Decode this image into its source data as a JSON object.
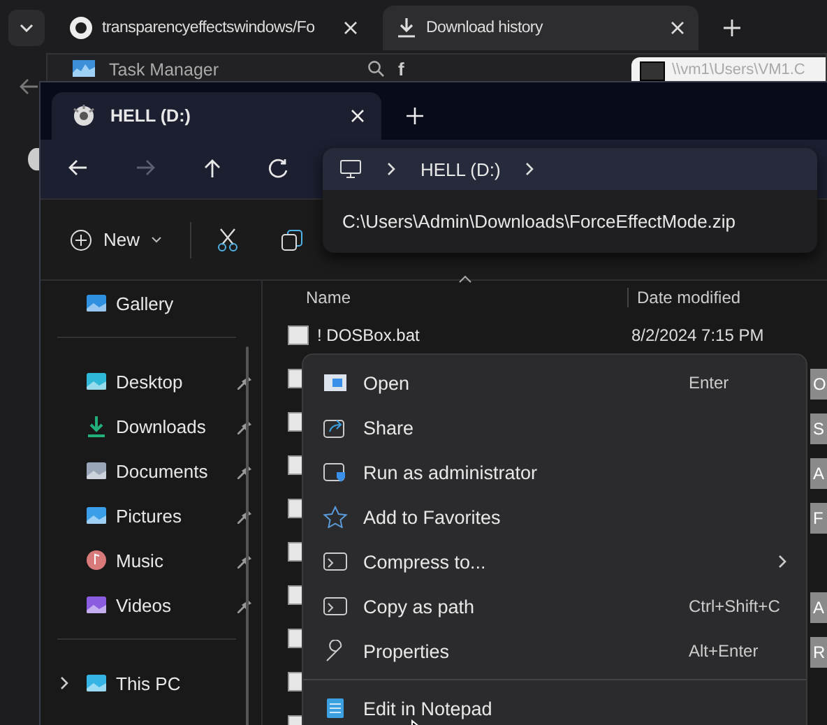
{
  "browser_tabs": [
    {
      "title": "transparencyeffectswindows/Fo",
      "selected": false
    },
    {
      "title": "Download history",
      "selected": true
    }
  ],
  "background_window": {
    "title": "Task Manager",
    "search_text": "f",
    "archive_path": "\\\\vm1\\Users\\VM1.C"
  },
  "explorer": {
    "tab": "HELL (D:)",
    "nav": [
      {
        "kind": "back",
        "disabled": false
      },
      {
        "kind": "forward",
        "disabled": true
      },
      {
        "kind": "up",
        "disabled": false
      },
      {
        "kind": "refresh",
        "disabled": false
      }
    ],
    "breadcrumb": [
      "HELL (D:)"
    ],
    "address_suggestion": "C:\\Users\\Admin\\Downloads\\ForceEffectMode.zip",
    "new_button": "New",
    "sidebar": [
      {
        "label": "Gallery",
        "kind": "gallery",
        "pinned": false
      },
      {
        "label": "Desktop",
        "kind": "desktop",
        "pinned": true
      },
      {
        "label": "Downloads",
        "kind": "downloads",
        "pinned": true
      },
      {
        "label": "Documents",
        "kind": "documents",
        "pinned": true
      },
      {
        "label": "Pictures",
        "kind": "pictures",
        "pinned": true
      },
      {
        "label": "Music",
        "kind": "music",
        "pinned": true
      },
      {
        "label": "Videos",
        "kind": "videos",
        "pinned": true
      },
      {
        "label": "This PC",
        "kind": "thispc",
        "pinned": false
      }
    ],
    "columns": [
      "Name",
      "Date modified"
    ],
    "rows": [
      {
        "name": "! DOSBox.bat",
        "date": "8/2/2024 7:15 PM"
      }
    ]
  },
  "context_menu": [
    {
      "label": "Open",
      "kind": "open",
      "shortcut": "Enter",
      "key_tip": "O"
    },
    {
      "label": "Share",
      "kind": "share",
      "key_tip": "S"
    },
    {
      "label": "Run as administrator",
      "kind": "admin",
      "key_tip": "A"
    },
    {
      "label": "Add to Favorites",
      "kind": "star",
      "key_tip": "F"
    },
    {
      "label": "Compress to...",
      "kind": "compress",
      "submenu": true
    },
    {
      "label": "Copy as path",
      "kind": "path",
      "shortcut": "Ctrl+Shift+C",
      "key_tip": "A"
    },
    {
      "label": "Properties",
      "kind": "wrench",
      "shortcut": "Alt+Enter",
      "key_tip": "R"
    },
    {
      "label": "Edit in Notepad",
      "kind": "notepad",
      "separator_before": true
    }
  ]
}
